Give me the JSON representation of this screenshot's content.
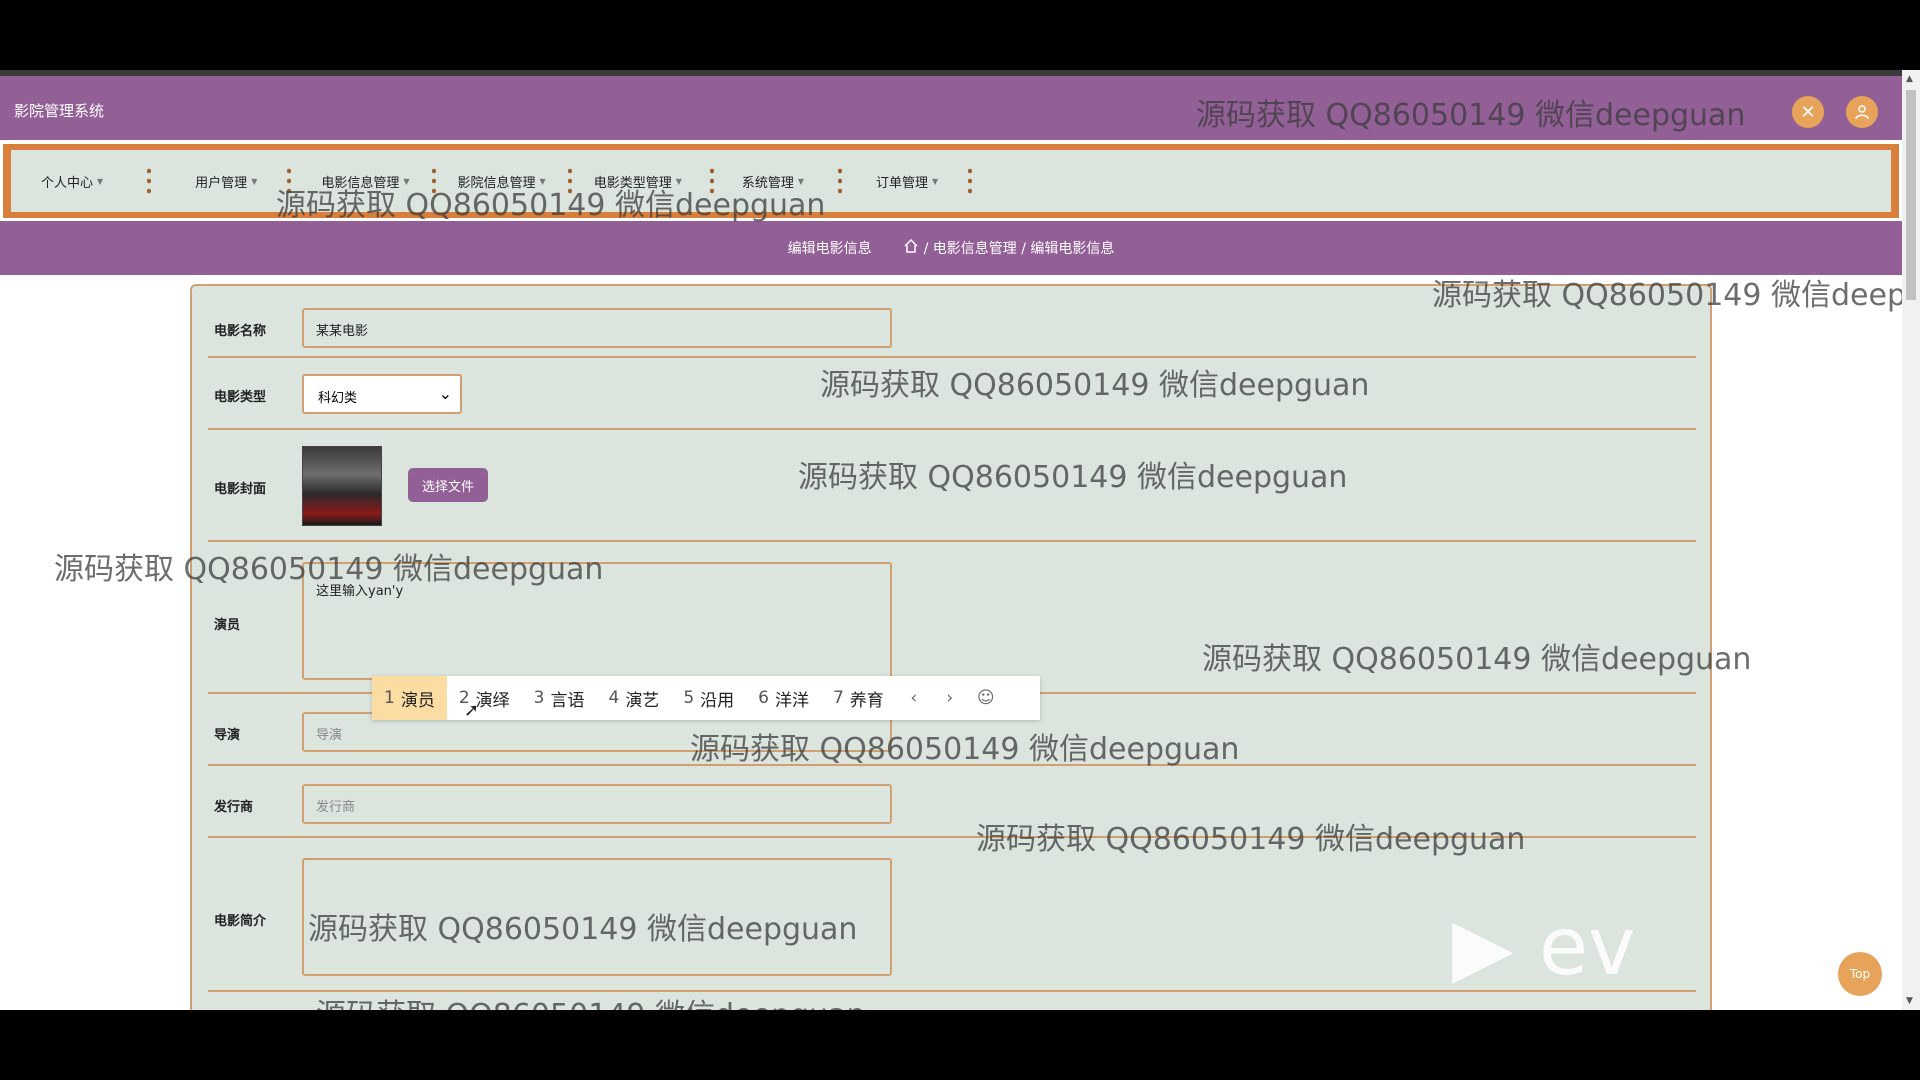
{
  "app": {
    "title": "影院管理系统"
  },
  "header_buttons": [
    {
      "icon": "fullscreen-icon",
      "glyph": "✕"
    },
    {
      "icon": "user-icon",
      "glyph": "👤"
    }
  ],
  "nav": [
    {
      "label": "个人中心"
    },
    {
      "label": "用户管理"
    },
    {
      "label": "电影信息管理"
    },
    {
      "label": "影院信息管理"
    },
    {
      "label": "电影类型管理"
    },
    {
      "label": "系统管理"
    },
    {
      "label": "订单管理"
    }
  ],
  "breadcrumb": {
    "page_name": "编辑电影信息",
    "path": "/ 电影信息管理 / 编辑电影信息"
  },
  "form": {
    "name_label": "电影名称",
    "name_value": "某某电影",
    "type_label": "电影类型",
    "type_value": "科幻类",
    "cover_label": "电影封面",
    "file_button": "选择文件",
    "actor_label": "演员",
    "actor_value": "这里输入yan'y",
    "director_label": "导演",
    "director_placeholder": "导演",
    "distributor_label": "发行商",
    "distributor_placeholder": "发行商",
    "intro_label": "电影简介"
  },
  "ime": {
    "candidates": [
      {
        "n": "1",
        "text": "演员"
      },
      {
        "n": "2",
        "text": "演绎"
      },
      {
        "n": "3",
        "text": "言语"
      },
      {
        "n": "4",
        "text": "演艺"
      },
      {
        "n": "5",
        "text": "沿用"
      },
      {
        "n": "6",
        "text": "洋洋"
      },
      {
        "n": "7",
        "text": "养育"
      }
    ],
    "prev": "‹",
    "next": "›",
    "emoji": "☺"
  },
  "watermark": "源码获取 QQ86050149 微信deepguan",
  "top_button": "Top",
  "overlay_logo": "ev",
  "colors": {
    "primary": "#925f96",
    "accent": "#e7a35a",
    "border": "#d1a072",
    "panel": "#dbe4dd"
  }
}
